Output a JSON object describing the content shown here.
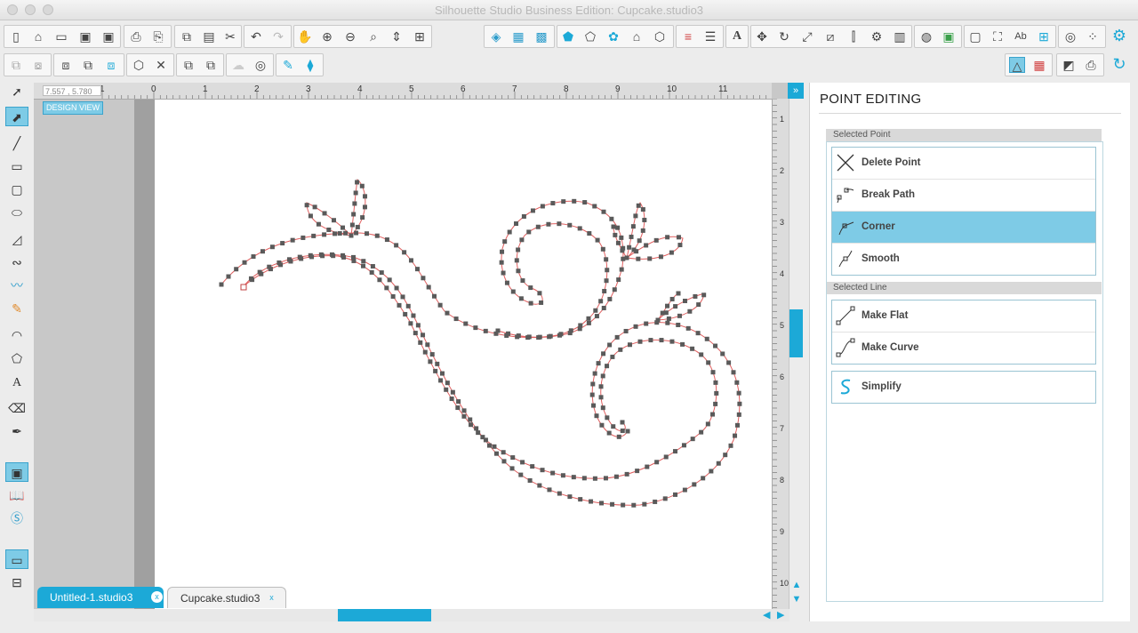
{
  "window": {
    "title": "Silhouette Studio Business Edition: Cupcake.studio3"
  },
  "canvas": {
    "coordinates": "7.557 , 5.780",
    "view_badge": "DESIGN VIEW",
    "ruler_top_labels": [
      "1",
      "0",
      "1",
      "2",
      "3",
      "4",
      "5",
      "6",
      "7",
      "8",
      "9",
      "10",
      "11"
    ],
    "ruler_right_labels": [
      "1",
      "2",
      "3",
      "4",
      "5",
      "6",
      "7",
      "8",
      "9",
      "10"
    ]
  },
  "tabs": [
    {
      "label": "Untitled-1.studio3",
      "active": true
    },
    {
      "label": "Cupcake.studio3",
      "active": false
    }
  ],
  "panel": {
    "title": "POINT EDITING",
    "selected_point": {
      "header": "Selected Point",
      "options": [
        "Delete Point",
        "Break Path",
        "Corner",
        "Smooth"
      ],
      "active": "Corner"
    },
    "selected_line": {
      "header": "Selected Line",
      "options": [
        "Make Flat",
        "Make Curve"
      ]
    },
    "simplify": "Simplify"
  },
  "colors": {
    "accent": "#1ca9d7",
    "highlight": "#7ecbe6",
    "path": "#e06060",
    "node": "#5a5a5a"
  }
}
